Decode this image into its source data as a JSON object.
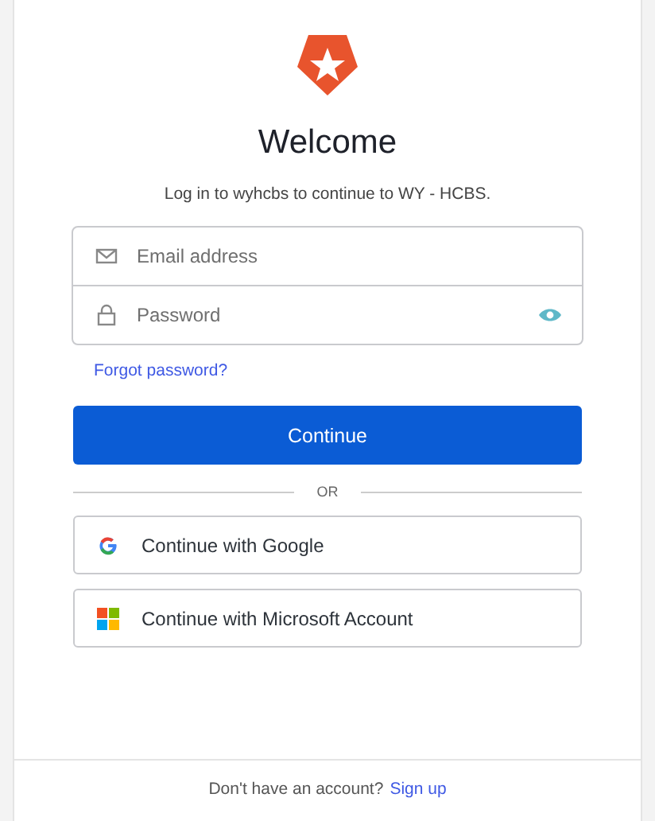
{
  "title": "Welcome",
  "subtitle": "Log in to wyhcbs to continue to WY - HCBS.",
  "fields": [
    {
      "kind": "email",
      "placeholder": "Email address"
    },
    {
      "kind": "password",
      "placeholder": "Password"
    }
  ],
  "forgot_link": "Forgot password?",
  "continue_button": "Continue",
  "separator": "OR",
  "social_buttons": [
    {
      "kind": "google",
      "label": "Continue with Google"
    },
    {
      "kind": "microsoft",
      "label": "Continue with Microsoft Account"
    }
  ],
  "footer": {
    "text": "Don't have an account?",
    "link": "Sign up"
  }
}
